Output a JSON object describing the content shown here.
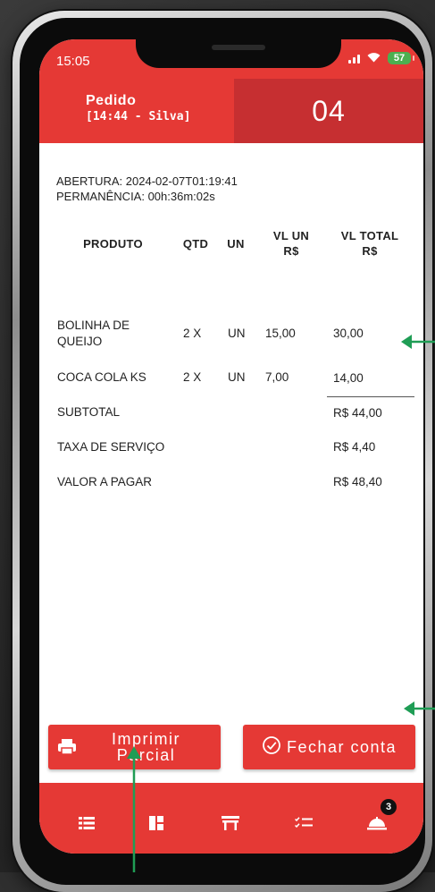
{
  "status_bar": {
    "time": "15:05",
    "battery": "57"
  },
  "header": {
    "title": "Pedido",
    "subtitle": "[14:44 - Silva]",
    "table_number": "04"
  },
  "meta": {
    "opening": "ABERTURA: 2024-02-07T01:19:41",
    "stay": "PERMANÊNCIA: 00h:36m:02s"
  },
  "table": {
    "headers": {
      "product": "PRODUTO",
      "qty": "QTD",
      "unit": "UN",
      "unit_price_1": "VL UN",
      "unit_price_2": "R$",
      "total_1": "VL TOTAL",
      "total_2": "R$"
    },
    "rows": [
      {
        "product": "BOLINHA DE QUEIJO",
        "qty": "2 X",
        "unit": "UN",
        "unit_price": "15,00",
        "total": "30,00"
      },
      {
        "product": "COCA COLA KS",
        "qty": "2 X",
        "unit": "UN",
        "unit_price": "7,00",
        "total": "14,00"
      }
    ]
  },
  "totals": [
    {
      "label": "SUBTOTAL",
      "value": "R$ 44,00"
    },
    {
      "label": "TAXA DE SERVIÇO",
      "value": "R$ 4,40"
    },
    {
      "label": "VALOR A PAGAR",
      "value": "R$ 48,40"
    }
  ],
  "buttons": {
    "print_partial": "Imprimir Parcial",
    "close_bill": "Fechar conta"
  },
  "tabbar": {
    "icons": [
      "list-icon",
      "layout-icon",
      "table-icon",
      "checklist-icon",
      "bell-icon"
    ],
    "notification_count": "3"
  },
  "colors": {
    "primary": "#e53935",
    "header_dark": "#c62f31",
    "annotation_arrow": "#1f9d55",
    "battery": "#4caf50"
  }
}
